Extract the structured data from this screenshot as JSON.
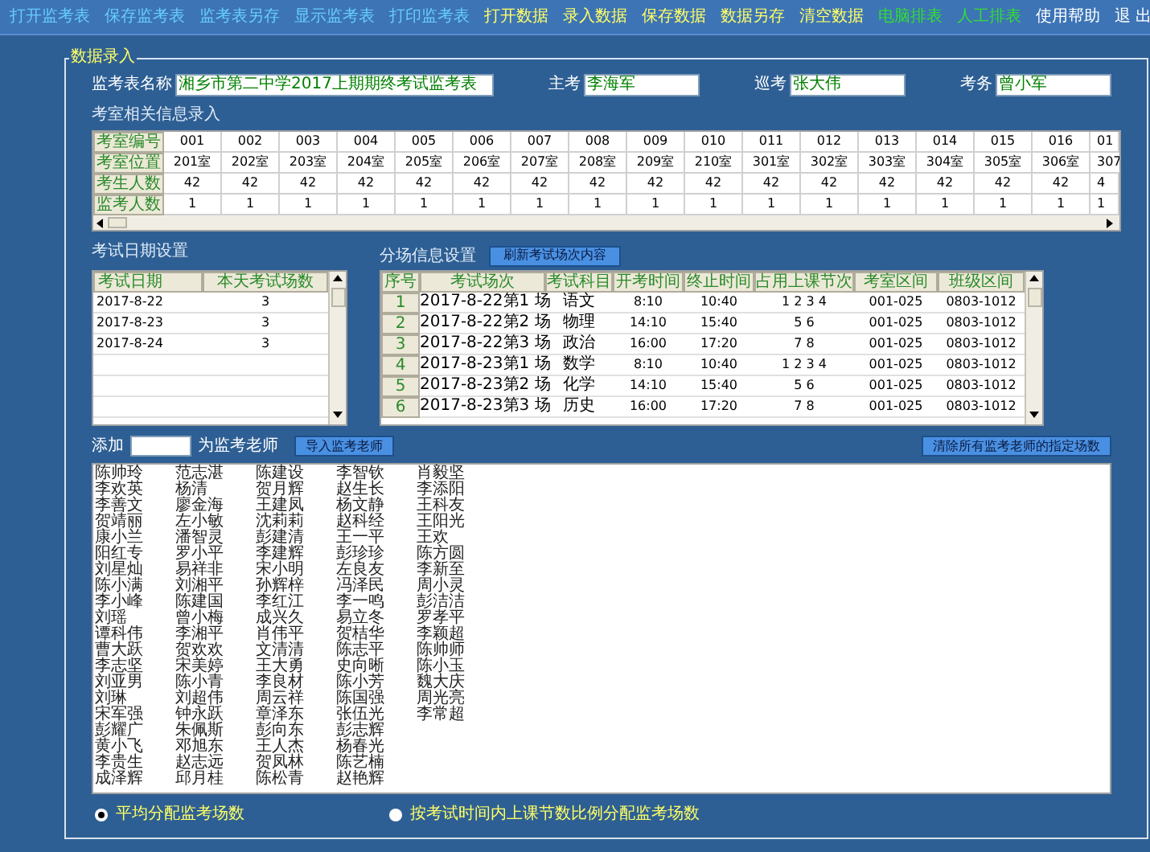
{
  "menu": [
    {
      "label": "打开监考表",
      "color": "#66ccff"
    },
    {
      "label": "保存监考表",
      "color": "#66ccff"
    },
    {
      "label": "监考表另存",
      "color": "#66ccff"
    },
    {
      "label": "显示监考表",
      "color": "#66ccff"
    },
    {
      "label": "打印监考表",
      "color": "#66ccff"
    },
    {
      "label": "打开数据",
      "color": "#ffff66"
    },
    {
      "label": "录入数据",
      "color": "#ffff66"
    },
    {
      "label": "保存数据",
      "color": "#ffff66"
    },
    {
      "label": "数据另存",
      "color": "#ffff66"
    },
    {
      "label": "清空数据",
      "color": "#ffff66"
    },
    {
      "label": "电脑排表",
      "color": "#33dd33"
    },
    {
      "label": "人工排表",
      "color": "#33dd33"
    },
    {
      "label": "使用帮助",
      "color": "#ffffff"
    },
    {
      "label": "退 出",
      "color": "#ffffff"
    }
  ],
  "group_title": "数据录入",
  "fields": [
    {
      "label": "监考表名称",
      "value": "湘乡市第二中学2017上期期终考试监考表"
    },
    {
      "label": "主考",
      "value": "李海军"
    },
    {
      "label": "巡考",
      "value": "张大伟"
    },
    {
      "label": "考务",
      "value": "曾小军"
    }
  ],
  "rooms": {
    "title": "考室相关信息录入",
    "rows": [
      {
        "header": "考室编号",
        "cells": [
          "001",
          "002",
          "003",
          "004",
          "005",
          "006",
          "007",
          "008",
          "009",
          "010",
          "011",
          "012",
          "013",
          "014",
          "015",
          "016",
          "01"
        ]
      },
      {
        "header": "考室位置",
        "cells": [
          "201室",
          "202室",
          "203室",
          "204室",
          "205室",
          "206室",
          "207室",
          "208室",
          "209室",
          "210室",
          "301室",
          "302室",
          "303室",
          "304室",
          "305室",
          "306室",
          "307"
        ]
      },
      {
        "header": "考生人数",
        "cells": [
          "42",
          "42",
          "42",
          "42",
          "42",
          "42",
          "42",
          "42",
          "42",
          "42",
          "42",
          "42",
          "42",
          "42",
          "42",
          "42",
          "4"
        ]
      },
      {
        "header": "监考人数",
        "cells": [
          "1",
          "1",
          "1",
          "1",
          "1",
          "1",
          "1",
          "1",
          "1",
          "1",
          "1",
          "1",
          "1",
          "1",
          "1",
          "1",
          "1"
        ]
      }
    ]
  },
  "dates": {
    "title": "考试日期设置",
    "columns": [
      "考试日期",
      "本天考试场数"
    ],
    "rows": [
      [
        "2017-8-22",
        "3"
      ],
      [
        "2017-8-23",
        "3"
      ],
      [
        "2017-8-24",
        "3"
      ]
    ]
  },
  "sessions": {
    "title": "分场信息设置",
    "refresh_button": "刷新考试场次内容",
    "columns": [
      "序号",
      "考试场次",
      "考试科目",
      "开考时间",
      "终止时间",
      "占用上课节次",
      "考室区间",
      "班级区间"
    ],
    "rows": [
      [
        "1",
        "2017-8-22第1 场",
        "语文",
        "8:10",
        "10:40",
        "1 2 3 4",
        "001-025",
        "0803-1012"
      ],
      [
        "2",
        "2017-8-22第2 场",
        "物理",
        "14:10",
        "15:40",
        "5 6",
        "001-025",
        "0803-1012"
      ],
      [
        "3",
        "2017-8-22第3 场",
        "政治",
        "16:00",
        "17:20",
        "7 8",
        "001-025",
        "0803-1012"
      ],
      [
        "4",
        "2017-8-23第1 场",
        "数学",
        "8:10",
        "10:40",
        "1 2 3 4",
        "001-025",
        "0803-1012"
      ],
      [
        "5",
        "2017-8-23第2 场",
        "化学",
        "14:10",
        "15:40",
        "5 6",
        "001-025",
        "0803-1012"
      ],
      [
        "6",
        "2017-8-23第3 场",
        "历史",
        "16:00",
        "17:20",
        "7 8",
        "001-025",
        "0803-1012"
      ]
    ]
  },
  "teachers": {
    "add_label": "添加",
    "add_suffix": "为监考老师",
    "import_button": "导入监考老师",
    "clear_button": "清除所有监考老师的指定场数",
    "names": [
      [
        "陈帅玲",
        "李欢英",
        "李善文",
        "贺靖丽",
        "康小兰",
        "阳红专",
        "刘星灿",
        "陈小满",
        "李小峰",
        "刘瑶",
        "谭科伟",
        "曹大跃",
        "李志坚",
        "刘亚男",
        "刘琳",
        "宋军强",
        "彭耀广",
        "黄小飞",
        "李贵生",
        "成泽辉"
      ],
      [
        "范志湛",
        "杨清",
        "廖金海",
        "左小敏",
        "潘智灵",
        "罗小平",
        "易祥非",
        "刘湘平",
        "陈建国",
        "曾小梅",
        "李湘平",
        "贺欢欢",
        "宋美婷",
        "陈小青",
        "刘超伟",
        "钟永跃",
        "朱佩斯",
        "邓旭东",
        "赵志远",
        "邱月桂"
      ],
      [
        "陈建设",
        "贺月辉",
        "王建凤",
        "沈莉莉",
        "彭建清",
        "李建辉",
        "宋小明",
        "孙辉梓",
        "李红江",
        "成兴久",
        "肖伟平",
        "文清清",
        "王大勇",
        "李良材",
        "周云祥",
        "章泽东",
        "彭向东",
        "王人杰",
        "贺凤林",
        "陈松青"
      ],
      [
        "李智钦",
        "赵生长",
        "杨文静",
        "赵科经",
        "王一平",
        "彭珍珍",
        "左良友",
        "冯泽民",
        "李一鸣",
        "易立冬",
        "贺桔华",
        "陈志平",
        "史向晰",
        "陈小芳",
        "陈国强",
        "张伍光",
        "彭志辉",
        "杨春光",
        "陈艺楠",
        "赵艳辉"
      ],
      [
        "肖毅坚",
        "李添阳",
        "王科友",
        "王阳光",
        "王欢",
        "陈方圆",
        "李新至",
        "周小灵",
        "彭洁洁",
        "罗孝平",
        "李颖超",
        "陈帅师",
        "陈小玉",
        "魏大庆",
        "周光亮",
        "李常超"
      ]
    ]
  },
  "distribution": [
    {
      "label": "平均分配监考场数",
      "selected": true
    },
    {
      "label": "按考试时间内上课节数比例分配监考场数",
      "selected": false
    }
  ]
}
